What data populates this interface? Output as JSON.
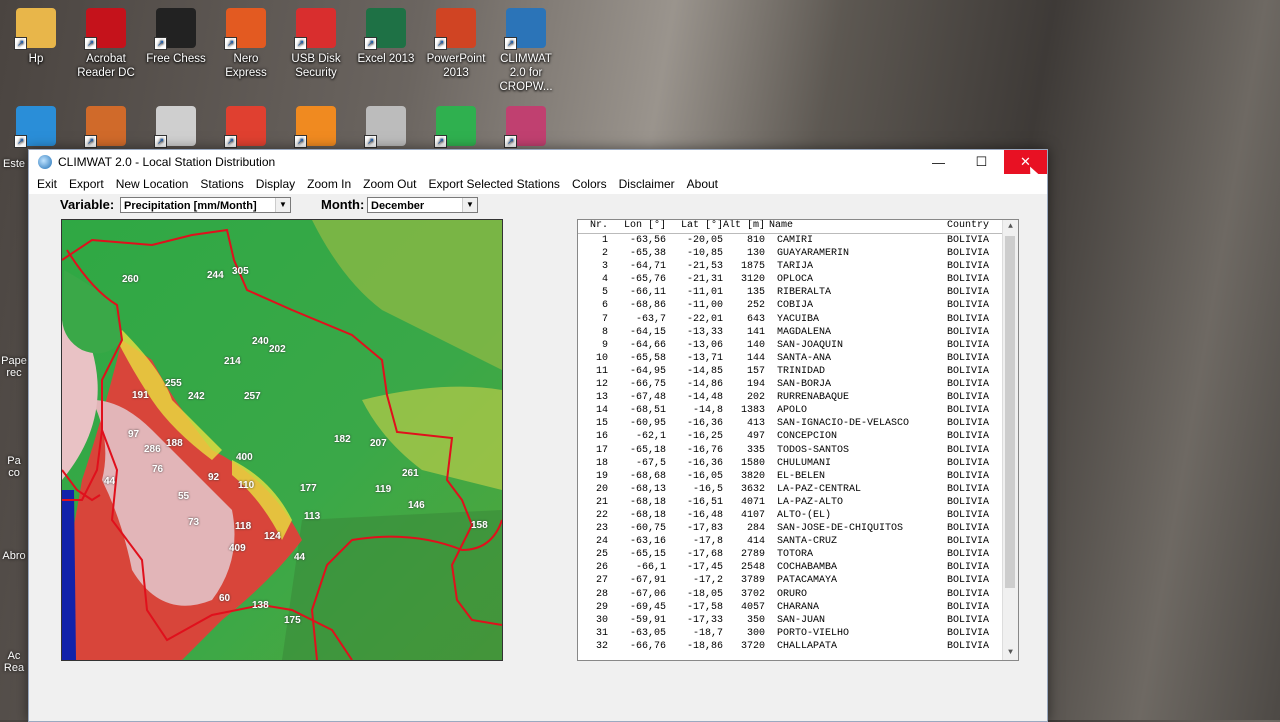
{
  "desktop": {
    "icons_row1": [
      {
        "label": "Hp",
        "color": "#e8b64a"
      },
      {
        "label": "Acrobat Reader DC",
        "color": "#c5121b"
      },
      {
        "label": "Free Chess",
        "color": "#222222"
      },
      {
        "label": "Nero Express",
        "color": "#e35a21"
      },
      {
        "label": "USB Disk Security",
        "color": "#d92e2e"
      },
      {
        "label": "Excel 2013",
        "color": "#1e7145"
      },
      {
        "label": "PowerPoint 2013",
        "color": "#d04423"
      },
      {
        "label": "CLIMWAT 2.0 for CROPW...",
        "color": "#2b74b8"
      }
    ],
    "icons_row2": [
      {
        "label": "",
        "color": "#2a8ed8"
      },
      {
        "label": "",
        "color": "#d06a2a"
      },
      {
        "label": "",
        "color": "#cfcfcf"
      },
      {
        "label": "",
        "color": "#e04030"
      },
      {
        "label": "",
        "color": "#f08a20"
      },
      {
        "label": "",
        "color": "#bcbcbc"
      },
      {
        "label": "",
        "color": "#2fb04f"
      },
      {
        "label": "",
        "color": "#c04070"
      }
    ],
    "left_edge": [
      "Este",
      "",
      "Pape rec",
      "Pa co",
      "Abro",
      "Ac Rea"
    ]
  },
  "window": {
    "title": "CLIMWAT 2.0 - Local Station Distribution",
    "min_glyph": "—",
    "max_glyph": "☐",
    "close_glyph": "✕",
    "menu": [
      "Exit",
      "Export",
      "New Location",
      "Stations",
      "Display",
      "Zoom In",
      "Zoom Out",
      "Export Selected Stations",
      "Colors",
      "Disclaimer",
      "About"
    ],
    "variable_label": "Variable:",
    "variable_value": "Precipitation [mm/Month]",
    "month_label": "Month:",
    "month_value": "December",
    "dd_glyph": "▼"
  },
  "map": {
    "labels": [
      {
        "t": "260"
      },
      {
        "t": "244"
      },
      {
        "t": "305"
      },
      {
        "t": "240"
      },
      {
        "t": "202"
      },
      {
        "t": "214"
      },
      {
        "t": "255"
      },
      {
        "t": "242"
      },
      {
        "t": "257"
      },
      {
        "t": "191"
      },
      {
        "t": "97"
      },
      {
        "t": "188"
      },
      {
        "t": "286"
      },
      {
        "t": "76"
      },
      {
        "t": "400"
      },
      {
        "t": "182"
      },
      {
        "t": "207"
      },
      {
        "t": "44"
      },
      {
        "t": "92"
      },
      {
        "t": "110"
      },
      {
        "t": "177"
      },
      {
        "t": "261"
      },
      {
        "t": "55"
      },
      {
        "t": "119"
      },
      {
        "t": "146"
      },
      {
        "t": "113"
      },
      {
        "t": "73"
      },
      {
        "t": "118"
      },
      {
        "t": "124"
      },
      {
        "t": "158"
      },
      {
        "t": "409"
      },
      {
        "t": "44"
      },
      {
        "t": "60"
      },
      {
        "t": "138"
      },
      {
        "t": "175"
      }
    ]
  },
  "list": {
    "headers": {
      "nr": "Nr.",
      "lon": "Lon [°]",
      "lat": "Lat [°]",
      "alt": "Alt [m]",
      "name": "Name",
      "country": "Country"
    },
    "rows": [
      [
        "1",
        "-63,56",
        "-20,05",
        "810",
        "CAMIRI",
        "BOLIVIA"
      ],
      [
        "2",
        "-65,38",
        "-10,85",
        "130",
        "GUAYARAMERIN",
        "BOLIVIA"
      ],
      [
        "3",
        "-64,71",
        "-21,53",
        "1875",
        "TARIJA",
        "BOLIVIA"
      ],
      [
        "4",
        "-65,76",
        "-21,31",
        "3120",
        "OPLOCA",
        "BOLIVIA"
      ],
      [
        "5",
        "-66,11",
        "-11,01",
        "135",
        "RIBERALTA",
        "BOLIVIA"
      ],
      [
        "6",
        "-68,86",
        "-11,00",
        "252",
        "COBIJA",
        "BOLIVIA"
      ],
      [
        "7",
        "-63,7",
        "-22,01",
        "643",
        "YACUIBA",
        "BOLIVIA"
      ],
      [
        "8",
        "-64,15",
        "-13,33",
        "141",
        "MAGDALENA",
        "BOLIVIA"
      ],
      [
        "9",
        "-64,66",
        "-13,06",
        "140",
        "SAN-JOAQUIN",
        "BOLIVIA"
      ],
      [
        "10",
        "-65,58",
        "-13,71",
        "144",
        "SANTA-ANA",
        "BOLIVIA"
      ],
      [
        "11",
        "-64,95",
        "-14,85",
        "157",
        "TRINIDAD",
        "BOLIVIA"
      ],
      [
        "12",
        "-66,75",
        "-14,86",
        "194",
        "SAN-BORJA",
        "BOLIVIA"
      ],
      [
        "13",
        "-67,48",
        "-14,48",
        "202",
        "RURRENABAQUE",
        "BOLIVIA"
      ],
      [
        "14",
        "-68,51",
        "-14,8",
        "1383",
        "APOLO",
        "BOLIVIA"
      ],
      [
        "15",
        "-60,95",
        "-16,36",
        "413",
        "SAN-IGNACIO-DE-VELASCO",
        "BOLIVIA"
      ],
      [
        "16",
        "-62,1",
        "-16,25",
        "497",
        "CONCEPCION",
        "BOLIVIA"
      ],
      [
        "17",
        "-65,18",
        "-16,76",
        "335",
        "TODOS-SANTOS",
        "BOLIVIA"
      ],
      [
        "18",
        "-67,5",
        "-16,36",
        "1580",
        "CHULUMANI",
        "BOLIVIA"
      ],
      [
        "19",
        "-68,68",
        "-16,05",
        "3820",
        "EL-BELEN",
        "BOLIVIA"
      ],
      [
        "20",
        "-68,13",
        "-16,5",
        "3632",
        "LA-PAZ-CENTRAL",
        "BOLIVIA"
      ],
      [
        "21",
        "-68,18",
        "-16,51",
        "4071",
        "LA-PAZ-ALTO",
        "BOLIVIA"
      ],
      [
        "22",
        "-68,18",
        "-16,48",
        "4107",
        "ALTO-(EL)",
        "BOLIVIA"
      ],
      [
        "23",
        "-60,75",
        "-17,83",
        "284",
        "SAN-JOSE-DE-CHIQUITOS",
        "BOLIVIA"
      ],
      [
        "24",
        "-63,16",
        "-17,8",
        "414",
        "SANTA-CRUZ",
        "BOLIVIA"
      ],
      [
        "25",
        "-65,15",
        "-17,68",
        "2789",
        "TOTORA",
        "BOLIVIA"
      ],
      [
        "26",
        "-66,1",
        "-17,45",
        "2548",
        "COCHABAMBA",
        "BOLIVIA"
      ],
      [
        "27",
        "-67,91",
        "-17,2",
        "3789",
        "PATACAMAYA",
        "BOLIVIA"
      ],
      [
        "28",
        "-67,06",
        "-18,05",
        "3702",
        "ORURO",
        "BOLIVIA"
      ],
      [
        "29",
        "-69,45",
        "-17,58",
        "4057",
        "CHARANA",
        "BOLIVIA"
      ],
      [
        "30",
        "-59,91",
        "-17,33",
        "350",
        "SAN-JUAN",
        "BOLIVIA"
      ],
      [
        "31",
        "-63,05",
        "-18,7",
        "300",
        "PORTO-VIELHO",
        "BOLIVIA"
      ],
      [
        "32",
        "-66,76",
        "-18,86",
        "3720",
        "CHALLAPATA",
        "BOLIVIA"
      ]
    ],
    "up_glyph": "▲",
    "down_glyph": "▼"
  }
}
